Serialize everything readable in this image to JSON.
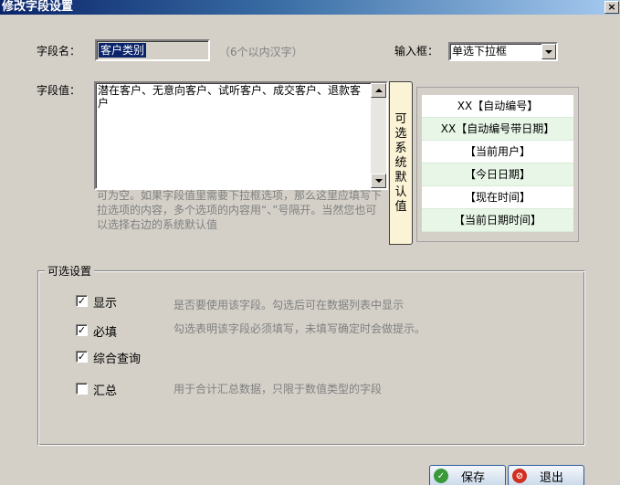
{
  "window": {
    "title": "修改字段设置",
    "close_glyph": "×"
  },
  "field_name": {
    "label": "字段名：",
    "value": "客户类别",
    "hint": "（6个以内汉字）"
  },
  "input_type": {
    "label": "输入框：",
    "selected": "单选下拉框"
  },
  "field_value": {
    "label": "字段值：",
    "value": "潜在客户、无意向客户、试听客户、成交客户、退款客户",
    "help": "可为空。如果字段值里需要下拉框选项，那么这里应填写下拉选项的内容，多个选项的内容用“、”号隔开。当然您也可以选择右边的系统默认值"
  },
  "defaults": {
    "tab_chars": [
      "可",
      "选",
      "系",
      "统",
      "默",
      "认",
      "值"
    ],
    "items": [
      "XX【自动编号】",
      "XX【自动编号带日期】",
      "【当前用户】",
      "【今日日期】",
      "【现在时间】",
      "【当前日期时间】"
    ]
  },
  "options": {
    "title": "可选设置",
    "items": [
      {
        "label": "显示",
        "checked": true,
        "desc": "是否要使用该字段。勾选后可在数据列表中显示"
      },
      {
        "label": "必填",
        "checked": true,
        "desc": "勾选表明该字段必须填写，未填写确定时会做提示。"
      },
      {
        "label": "综合查询",
        "checked": true,
        "desc": ""
      },
      {
        "label": "汇总",
        "checked": false,
        "desc": "用于合计汇总数据，只限于数值类型的字段"
      }
    ],
    "check_glyph": "✓"
  },
  "buttons": {
    "save": {
      "label": "保存",
      "icon": "check-icon",
      "glyph": "✓",
      "color": "#3a9a3a"
    },
    "exit": {
      "label": "退出",
      "icon": "no-entry-icon",
      "glyph": "⊘",
      "color": "#d03020"
    }
  }
}
